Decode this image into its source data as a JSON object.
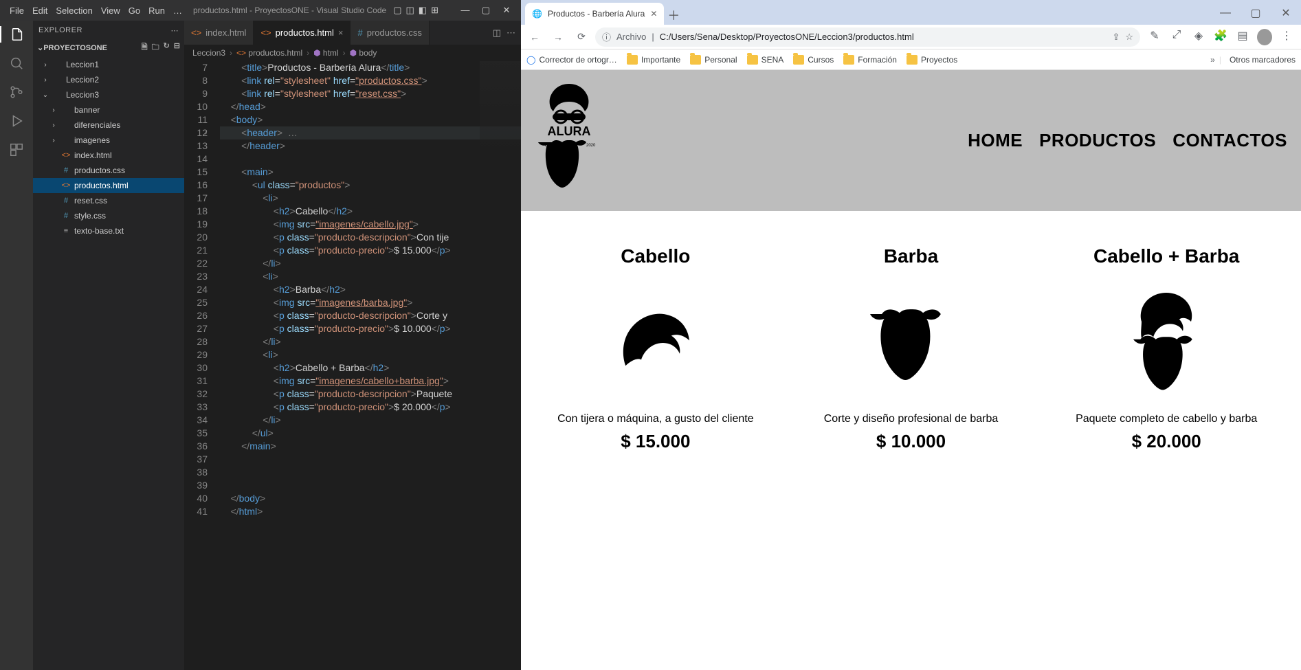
{
  "vscode": {
    "menus": [
      "File",
      "Edit",
      "Selection",
      "View",
      "Go",
      "Run",
      "…"
    ],
    "title": "productos.html - ProyectosONE - Visual Studio Code",
    "explorer": {
      "title": "EXPLORER",
      "project": "PROYECTOSONE",
      "tree": [
        {
          "t": "folder",
          "label": "Leccion1",
          "indent": 0,
          "open": false
        },
        {
          "t": "folder",
          "label": "Leccion2",
          "indent": 0,
          "open": false
        },
        {
          "t": "folder",
          "label": "Leccion3",
          "indent": 0,
          "open": true
        },
        {
          "t": "folder",
          "label": "banner",
          "indent": 1,
          "open": false
        },
        {
          "t": "folder",
          "label": "diferenciales",
          "indent": 1,
          "open": false
        },
        {
          "t": "folder",
          "label": "imagenes",
          "indent": 1,
          "open": false
        },
        {
          "t": "file",
          "label": "index.html",
          "indent": 1,
          "cls": "orange"
        },
        {
          "t": "file",
          "label": "productos.css",
          "indent": 1,
          "cls": "blue",
          "prefix": "#"
        },
        {
          "t": "file",
          "label": "productos.html",
          "indent": 1,
          "cls": "orange",
          "sel": true
        },
        {
          "t": "file",
          "label": "reset.css",
          "indent": 1,
          "cls": "blue",
          "prefix": "#"
        },
        {
          "t": "file",
          "label": "style.css",
          "indent": 1,
          "cls": "blue",
          "prefix": "#"
        },
        {
          "t": "file",
          "label": "texto-base.txt",
          "indent": 1,
          "cls": "txtc",
          "prefix": "≡"
        }
      ]
    },
    "tabs": [
      {
        "label": "index.html",
        "cls": "orange",
        "active": false
      },
      {
        "label": "productos.html",
        "cls": "orange",
        "active": true
      },
      {
        "label": "productos.css",
        "cls": "blue",
        "active": false
      }
    ],
    "breadcrumb": [
      "Leccion3",
      "productos.html",
      "html",
      "body"
    ],
    "code_start": 7,
    "code": [
      "        <title>Productos - Barbería Alura</title>",
      "        <link rel=\"stylesheet\" href=\"productos.css\">",
      "        <link rel=\"stylesheet\" href=\"reset.css\">",
      "    </head>",
      "    <body>",
      "        <header> …",
      "        </header>",
      "",
      "        <main>",
      "            <ul class=\"productos\">",
      "                <li>",
      "                    <h2>Cabello</h2>",
      "                    <img src=\"imagenes/cabello.jpg\">",
      "                    <p class=\"producto-descripcion\">Con tije",
      "                    <p class=\"producto-precio\">$ 15.000</p>",
      "                </li>",
      "                <li>",
      "                    <h2>Barba</h2>",
      "                    <img src=\"imagenes/barba.jpg\">",
      "                    <p class=\"producto-descripcion\">Corte y",
      "                    <p class=\"producto-precio\">$ 10.000</p>",
      "                </li>",
      "                <li>",
      "                    <h2>Cabello + Barba</h2>",
      "                    <img src=\"imagenes/cabello+barba.jpg\">",
      "                    <p class=\"producto-descripcion\">Paquete",
      "                    <p class=\"producto-precio\">$ 20.000</p>",
      "                </li>",
      "            </ul>",
      "        </main>",
      "",
      "",
      "",
      "    </body>",
      "    </html>"
    ]
  },
  "browser": {
    "tab_title": "Productos - Barbería Alura",
    "addr_prefix": "Archivo",
    "url": "C:/Users/Sena/Desktop/ProyectosONE/Leccion3/productos.html",
    "bookmarks": [
      "Corrector de ortogr…",
      "Importante",
      "Personal",
      "SENA",
      "Cursos",
      "Formación",
      "Proyectos"
    ],
    "bm_more": "Otros marcadores",
    "nav": [
      "HOME",
      "PRODUCTOS",
      "CONTACTOS"
    ],
    "products": [
      {
        "title": "Cabello",
        "desc": "Con tijera o máquina, a gusto del cliente",
        "price": "$ 15.000"
      },
      {
        "title": "Barba",
        "desc": "Corte y diseño profesional de barba",
        "price": "$ 10.000"
      },
      {
        "title": "Cabello + Barba",
        "desc": "Paquete completo de cabello y barba",
        "price": "$ 20.000"
      }
    ]
  }
}
